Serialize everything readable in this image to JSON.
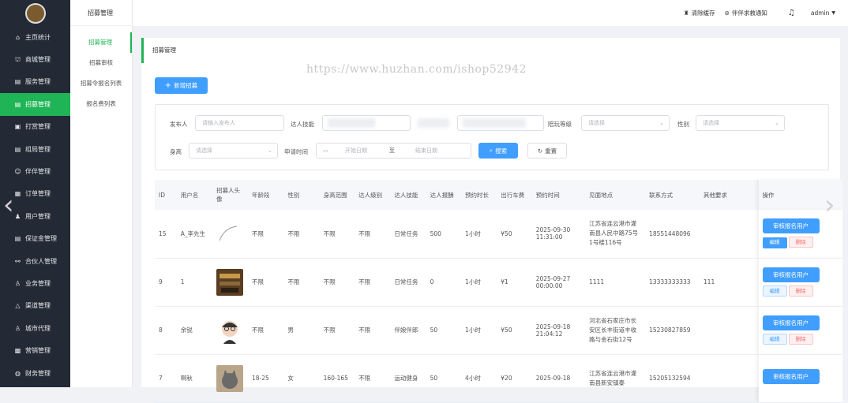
{
  "sidebar": {
    "items": [
      {
        "label": "主页统计",
        "icon": "home-icon",
        "glyph": "⌂"
      },
      {
        "label": "商城管理",
        "icon": "shop-icon",
        "glyph": "⛫"
      },
      {
        "label": "服务管理",
        "icon": "service-icon",
        "glyph": "▤"
      },
      {
        "label": "招募管理",
        "icon": "recruit-icon",
        "glyph": "▤",
        "active": true
      },
      {
        "label": "打赏管理",
        "icon": "reward-icon",
        "glyph": "▣"
      },
      {
        "label": "组局管理",
        "icon": "group-icon",
        "glyph": "▤"
      },
      {
        "label": "伴伴管理",
        "icon": "partner-icon",
        "glyph": "☺"
      },
      {
        "label": "订单管理",
        "icon": "order-icon",
        "glyph": "▦"
      },
      {
        "label": "用户管理",
        "icon": "user-icon",
        "glyph": "♟"
      },
      {
        "label": "保证金管理",
        "icon": "deposit-icon",
        "glyph": "▤"
      },
      {
        "label": "合伙人管理",
        "icon": "cooperate-icon",
        "glyph": "⚯"
      },
      {
        "label": "业务管理",
        "icon": "business-icon",
        "glyph": "♙"
      },
      {
        "label": "渠道管理",
        "icon": "channel-icon",
        "glyph": "△"
      },
      {
        "label": "城市代理",
        "icon": "city-agent-icon",
        "glyph": "♙"
      },
      {
        "label": "营销管理",
        "icon": "marketing-icon",
        "glyph": "▩"
      },
      {
        "label": "财务管理",
        "icon": "finance-icon",
        "glyph": "◍"
      }
    ]
  },
  "submenu": {
    "title": "招募管理",
    "items": [
      "招募管理",
      "招募审核",
      "招募令报名列表",
      "报名费列表"
    ]
  },
  "topbar": {
    "clear_cache": "清除缓存",
    "notice": "伴伴求救通知",
    "user": "admin"
  },
  "watermark": "https://www.huzhan.com/ishop52942",
  "tab": "招募管理",
  "add_button": "新增招募",
  "filters": {
    "publisher_label": "发布人",
    "publisher_placeholder": "请输入发布人",
    "skill_label": "达人技能",
    "level_label": "陪玩等级",
    "level_placeholder": "请选择",
    "gender_label": "性别",
    "gender_placeholder": "请选择",
    "height_label": "身高",
    "height_placeholder": "请选择",
    "time_label": "申请时间",
    "start_placeholder": "开始日期",
    "to": "至",
    "end_placeholder": "结束日期",
    "search": "搜索",
    "reset": "重置"
  },
  "table": {
    "headers": [
      "ID",
      "用户名",
      "招募人头像",
      "年龄段",
      "性别",
      "身高范围",
      "达人级别",
      "达人技能",
      "达人报酬",
      "预约时长",
      "出行车费",
      "预约时间",
      "见面地点",
      "联系方式",
      "其他要求",
      "操作"
    ],
    "rows": [
      {
        "id": "15",
        "name": "A_李先生",
        "avatar": "line",
        "age": "不限",
        "gender": "不限",
        "height": "不限",
        "level": "不限",
        "skill": "日常任务",
        "pay": "500",
        "duration": "1小时",
        "fare": "¥50",
        "time1": "2025-09-30",
        "time2": "11:31:00",
        "addr": "江苏省连云港市灌南县人民中路75号1号楼116号",
        "phone": "18551448096",
        "other": ""
      },
      {
        "id": "9",
        "name": "1",
        "avatar": "photo1",
        "age": "不限",
        "gender": "不限",
        "height": "不限",
        "level": "不限",
        "skill": "日常任务",
        "pay": "0",
        "duration": "1小时",
        "fare": "¥1",
        "time1": "2025-09-27",
        "time2": "00:00:00",
        "addr": "1111",
        "phone": "13333333333",
        "other": "111"
      },
      {
        "id": "8",
        "name": "余锐",
        "avatar": "cartoon",
        "age": "不限",
        "gender": "男",
        "height": "不限",
        "level": "不限",
        "skill": "伴娘伴郎",
        "pay": "50",
        "duration": "1小时",
        "fare": "¥50",
        "time1": "2025-09-18",
        "time2": "21:04:12",
        "addr": "河北省石家庄市长安区长丰街道丰收路与金石街12号",
        "phone": "15230827859",
        "other": ""
      },
      {
        "id": "7",
        "name": "啊秋",
        "avatar": "cat",
        "age": "18-25",
        "gender": "女",
        "height": "160-165",
        "level": "不限",
        "skill": "运动健身",
        "pay": "50",
        "duration": "4小时",
        "fare": "¥20",
        "time1": "2025-09-18",
        "time2": "",
        "addr": "江苏省连云港市灌南县新安镇泰",
        "phone": "15205132594",
        "other": ""
      }
    ],
    "audit": "审核报名用户",
    "edit": "编辑",
    "delete": "删除"
  }
}
